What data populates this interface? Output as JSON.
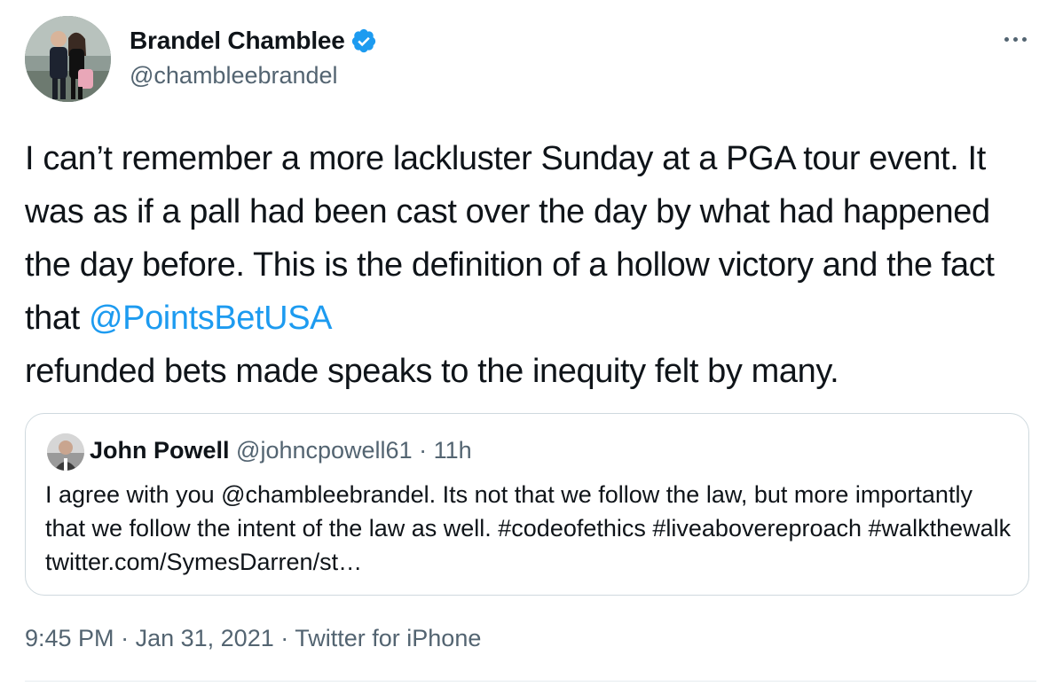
{
  "author": {
    "display_name": "Brandel Chamblee",
    "handle": "@chambleebrandel",
    "verified": true
  },
  "tweet": {
    "text_part1": "I can’t remember a more lackluster Sunday at a PGA tour event. It was as if a pall had been cast over the day by what had happened the day before. This is the definition of a hollow victory and the fact that ",
    "mention": "@PointsBetUSA",
    "text_part2": "\nrefunded bets made speaks to the inequity felt by many."
  },
  "quote": {
    "display_name": "John Powell",
    "handle": "@johncpowell61",
    "separator": "·",
    "time": "11h",
    "text": "I agree with you @chambleebrandel. Its not that we follow the law, but more importantly that we follow the intent of the law as well. #codeofethics #liveabovereproach #walkthewalk twitter.com/SymesDarren/st…"
  },
  "footer": {
    "time": "9:45 PM",
    "separator": "·",
    "date": "Jan 31, 2021",
    "source": "Twitter for iPhone"
  },
  "colors": {
    "link": "#1d9bf0",
    "secondary_text": "#536471",
    "primary_text": "#0f1419",
    "border": "#cfd9de"
  },
  "icons": {
    "verified": "verified-badge-icon",
    "more": "more-options-icon"
  }
}
